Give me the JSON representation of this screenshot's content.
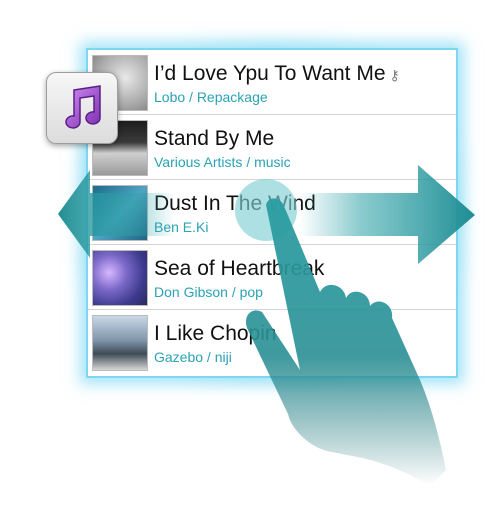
{
  "app": {
    "icon": "music-note-icon",
    "accent_color": "#2aa3b4",
    "glow_color": "#5acdf0"
  },
  "playlist": {
    "items": [
      {
        "title": "I’d Love Ypu To Want Me",
        "subtitle": "Lobo / Repackage",
        "has_lock": true
      },
      {
        "title": "Stand By Me",
        "subtitle": "Various Artists / music",
        "has_lock": false
      },
      {
        "title": "Dust In The Wind",
        "subtitle": "Ben E.Ki",
        "has_lock": false
      },
      {
        "title": "Sea of Heartbreak",
        "subtitle": "Don Gibson / pop",
        "has_lock": false
      },
      {
        "title": "I Like Chopin",
        "subtitle": "Gazebo / niji",
        "has_lock": false
      }
    ]
  },
  "overlay": {
    "left_arrow_icon": "arrow-left-icon",
    "right_arrow_icon": "arrow-right-icon",
    "hand_icon": "swipe-hand-icon",
    "tap_icon": "tap-circle-icon",
    "arrow_color": "#2aa0a6"
  }
}
